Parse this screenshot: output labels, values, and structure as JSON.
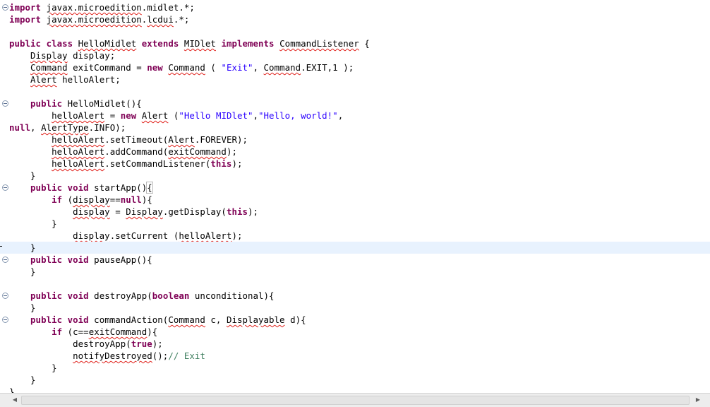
{
  "editor": {
    "lines": [
      [
        {
          "t": "import",
          "c": "kw"
        },
        {
          "t": " "
        },
        {
          "t": "javax.microedition",
          "c": "sq"
        },
        {
          "t": ".midlet.*;"
        }
      ],
      [
        {
          "t": "import",
          "c": "kw"
        },
        {
          "t": " "
        },
        {
          "t": "javax.microedition",
          "c": "sq"
        },
        {
          "t": "."
        },
        {
          "t": "lcdui",
          "c": "sq"
        },
        {
          "t": ".*;"
        }
      ],
      [],
      [
        {
          "t": "public",
          "c": "kw"
        },
        {
          "t": " "
        },
        {
          "t": "class",
          "c": "kw"
        },
        {
          "t": " "
        },
        {
          "t": "HelloMidlet",
          "c": "sq"
        },
        {
          "t": " "
        },
        {
          "t": "extends",
          "c": "kw"
        },
        {
          "t": " "
        },
        {
          "t": "MIDlet",
          "c": "sq"
        },
        {
          "t": " "
        },
        {
          "t": "implements",
          "c": "kw"
        },
        {
          "t": " "
        },
        {
          "t": "CommandListener",
          "c": "sq"
        },
        {
          "t": " {"
        }
      ],
      [
        {
          "t": "    "
        },
        {
          "t": "Display",
          "c": "sq"
        },
        {
          "t": " display;"
        }
      ],
      [
        {
          "t": "    "
        },
        {
          "t": "Command",
          "c": "sq"
        },
        {
          "t": " exitCommand = "
        },
        {
          "t": "new",
          "c": "kw"
        },
        {
          "t": " "
        },
        {
          "t": "Command",
          "c": "sq"
        },
        {
          "t": " ( "
        },
        {
          "t": "\"Exit\"",
          "c": "str"
        },
        {
          "t": ", "
        },
        {
          "t": "Command",
          "c": "sq"
        },
        {
          "t": ".EXIT,1 );"
        }
      ],
      [
        {
          "t": "    "
        },
        {
          "t": "Alert",
          "c": "sq"
        },
        {
          "t": " helloAlert;"
        }
      ],
      [],
      [
        {
          "t": "    "
        },
        {
          "t": "public",
          "c": "kw"
        },
        {
          "t": " HelloMidlet(){"
        }
      ],
      [
        {
          "t": "        "
        },
        {
          "t": "helloAlert",
          "c": "sq"
        },
        {
          "t": " = "
        },
        {
          "t": "new",
          "c": "kw"
        },
        {
          "t": " "
        },
        {
          "t": "Alert",
          "c": "sq"
        },
        {
          "t": " ("
        },
        {
          "t": "\"Hello MIDlet\"",
          "c": "str"
        },
        {
          "t": ","
        },
        {
          "t": "\"Hello, world!\"",
          "c": "str"
        },
        {
          "t": ","
        }
      ],
      [
        {
          "t": "null",
          "c": "kw"
        },
        {
          "t": ", "
        },
        {
          "t": "AlertType",
          "c": "sq"
        },
        {
          "t": ".INFO);"
        }
      ],
      [
        {
          "t": "        "
        },
        {
          "t": "helloAlert",
          "c": "sq"
        },
        {
          "t": ".setTimeout("
        },
        {
          "t": "Alert",
          "c": "sq"
        },
        {
          "t": ".FOREVER);"
        }
      ],
      [
        {
          "t": "        "
        },
        {
          "t": "helloAlert",
          "c": "sq"
        },
        {
          "t": ".addCommand("
        },
        {
          "t": "exitCommand",
          "c": "sq"
        },
        {
          "t": ");"
        }
      ],
      [
        {
          "t": "        "
        },
        {
          "t": "helloAlert",
          "c": "sq"
        },
        {
          "t": ".setCommandListener("
        },
        {
          "t": "this",
          "c": "kw"
        },
        {
          "t": ");"
        }
      ],
      [
        {
          "t": "    }"
        }
      ],
      [
        {
          "t": "    "
        },
        {
          "t": "public",
          "c": "kw"
        },
        {
          "t": " "
        },
        {
          "t": "void",
          "c": "kw"
        },
        {
          "t": " startApp()"
        },
        {
          "t": "{",
          "c": "caret-box"
        }
      ],
      [
        {
          "t": "        "
        },
        {
          "t": "if",
          "c": "kw"
        },
        {
          "t": " ("
        },
        {
          "t": "display",
          "c": "sq"
        },
        {
          "t": "=="
        },
        {
          "t": "null",
          "c": "kw"
        },
        {
          "t": "){"
        }
      ],
      [
        {
          "t": "            "
        },
        {
          "t": "display",
          "c": "sq"
        },
        {
          "t": " = "
        },
        {
          "t": "Display",
          "c": "sq"
        },
        {
          "t": ".getDisplay("
        },
        {
          "t": "this",
          "c": "kw"
        },
        {
          "t": ");"
        }
      ],
      [
        {
          "t": "        }"
        }
      ],
      [
        {
          "t": "            "
        },
        {
          "t": "display",
          "c": "sq"
        },
        {
          "t": ".setCurrent ("
        },
        {
          "t": "helloAlert",
          "c": "sq"
        },
        {
          "t": ");"
        }
      ],
      [
        {
          "t": "    }"
        }
      ],
      [
        {
          "t": "    "
        },
        {
          "t": "public",
          "c": "kw"
        },
        {
          "t": " "
        },
        {
          "t": "void",
          "c": "kw"
        },
        {
          "t": " pauseApp(){"
        }
      ],
      [
        {
          "t": "    }"
        }
      ],
      [],
      [
        {
          "t": "    "
        },
        {
          "t": "public",
          "c": "kw"
        },
        {
          "t": " "
        },
        {
          "t": "void",
          "c": "kw"
        },
        {
          "t": " destroyApp("
        },
        {
          "t": "boolean",
          "c": "kw"
        },
        {
          "t": " unconditional){"
        }
      ],
      [
        {
          "t": "    }"
        }
      ],
      [
        {
          "t": "    "
        },
        {
          "t": "public",
          "c": "kw"
        },
        {
          "t": " "
        },
        {
          "t": "void",
          "c": "kw"
        },
        {
          "t": " commandAction("
        },
        {
          "t": "Command",
          "c": "sq"
        },
        {
          "t": " c, "
        },
        {
          "t": "Displayable",
          "c": "sq"
        },
        {
          "t": " d){"
        }
      ],
      [
        {
          "t": "        "
        },
        {
          "t": "if",
          "c": "kw"
        },
        {
          "t": " (c=="
        },
        {
          "t": "exitCommand",
          "c": "sq"
        },
        {
          "t": "){"
        }
      ],
      [
        {
          "t": "            destroyApp("
        },
        {
          "t": "true",
          "c": "kw"
        },
        {
          "t": ");"
        }
      ],
      [
        {
          "t": "            "
        },
        {
          "t": "notifyDestroyed",
          "c": "sq"
        },
        {
          "t": "();"
        },
        {
          "t": "// Exit",
          "c": "cmt"
        }
      ],
      [
        {
          "t": "        }"
        }
      ],
      [
        {
          "t": "    }"
        }
      ],
      [
        {
          "t": "}"
        }
      ]
    ],
    "fold_markers": [
      0,
      8,
      15,
      21,
      24,
      26
    ],
    "current_line": 20,
    "colors": {
      "keyword": "#7f0055",
      "string": "#2a00ff",
      "comment": "#3f7f5f",
      "current_line": "#e8f2fe",
      "squiggle": "#e0201a"
    }
  },
  "scrollbar": {
    "left_arrow": "◀",
    "right_arrow": "▶"
  }
}
